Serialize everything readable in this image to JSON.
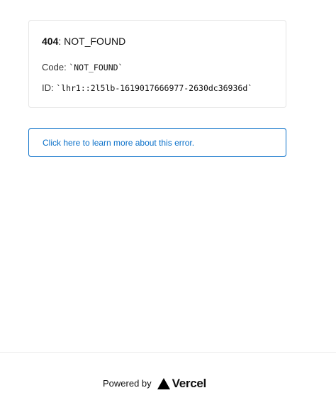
{
  "error": {
    "status_code": "404",
    "status_text": ": NOT_FOUND",
    "code_label": "Code: ",
    "code_value": "`NOT_FOUND`",
    "id_label": "ID: ",
    "id_value": "`lhr1::2l5lb-1619017666977-2630dc36936d`"
  },
  "learn_more": {
    "label": "Click here to learn more about this error."
  },
  "footer": {
    "powered_by": "Powered by",
    "brand": "Vercel",
    "brand_icon": "vercel-triangle-icon"
  },
  "colors": {
    "link": "#0a70c9",
    "border": "#e5e5e5",
    "text": "#111111"
  }
}
